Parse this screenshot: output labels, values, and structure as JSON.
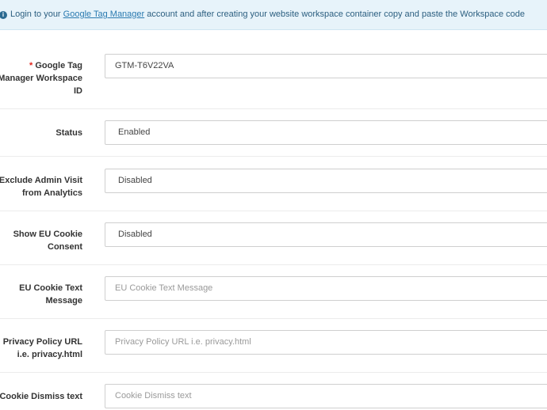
{
  "alert": {
    "text_before": "Login to your ",
    "link_text": "Google Tag Manager",
    "text_after": " account and after creating your website workspace container copy and paste the Workspace code"
  },
  "fields": {
    "workspace_id": {
      "required_mark": "*",
      "label_line1": "Google Tag",
      "label_line2": "Manager Workspace",
      "label_line3": "ID",
      "value": "GTM-T6V22VA"
    },
    "status": {
      "label": "Status",
      "value": "Enabled"
    },
    "exclude_admin": {
      "label_line1": "Exclude Admin Visit",
      "label_line2": "from Analytics",
      "value": "Disabled"
    },
    "eu_cookie_consent": {
      "label_line1": "Show EU Cookie",
      "label_line2": "Consent",
      "value": "Disabled"
    },
    "eu_cookie_text": {
      "label_line1": "EU Cookie Text",
      "label_line2": "Message",
      "placeholder": "EU Cookie Text Message"
    },
    "privacy_url": {
      "label_line1": "Privacy Policy URL",
      "label_line2": "i.e. privacy.html",
      "placeholder": "Privacy Policy URL i.e. privacy.html"
    },
    "cookie_dismiss": {
      "label": "Cookie Dismiss text",
      "placeholder": "Cookie Dismiss text"
    }
  },
  "colors": {
    "alert_bg": "#e7f3fa",
    "required": "#e2231a",
    "link": "#2a7ab0"
  }
}
